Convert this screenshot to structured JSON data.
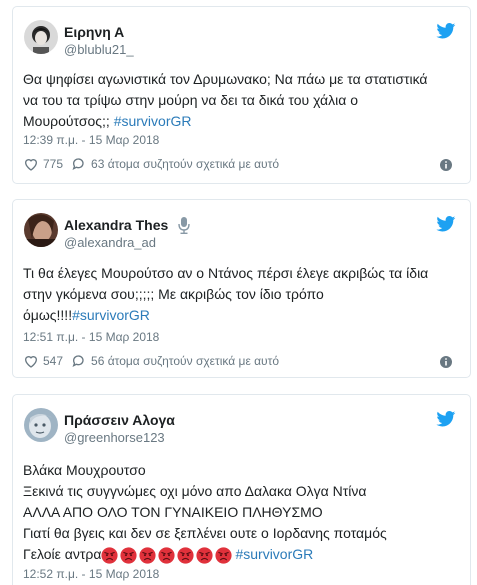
{
  "tweets": [
    {
      "name": "Ειρηνη Α",
      "handle": "@blublu21_",
      "text_lines": [
        "Θα ψηφίσει αγωνιστικά τον Δρυμωνακο; Να πάω με τα στατιστικά",
        "να του τα τρίψω στην μούρη να δει τα δικά του χάλια ο"
      ],
      "last_line_text": "Μουρούτσος;; ",
      "hashtag": "#survivorGR",
      "timestamp": "12:39 π.μ. - 15 Μαρ 2018",
      "likes": "775",
      "replies_text": "63 άτομα συζητούν σχετικά με αυτό"
    },
    {
      "name": "Alexandra Thes",
      "handle": "@alexandra_ad",
      "text_lines": [
        "Τι θα έλεγες Μουρούτσο αν ο Ντάνος πέρσι έλεγε ακριβώς τα ίδια",
        "στην γκόμενα σου;;;;; Με ακριβώς τον ίδιο τρόπο"
      ],
      "last_line_text": "όμως!!!!",
      "hashtag": "#survivorGR",
      "timestamp": "12:51 π.μ. - 15 Μαρ 2018",
      "likes": "547",
      "replies_text": "56 άτομα συζητούν σχετικά με αυτό"
    },
    {
      "name": "Πράσσειν Αλογα",
      "handle": "@greenhorse123",
      "text_lines": [
        "Βλάκα Μουχρουτσο",
        "Ξεκινά τις συγγνώμες οχι μόνο απο Δαλακα Ολγα Ντίνα",
        "ΑΛΛΑ ΑΠΟ ΟΛΟ ΤΟΝ ΓΥΝΑΙΚΕΙΟ ΠΛΗΘΥΣΜΟ",
        "Γιατί θα βγεις και δεν σε ξεπλένει ουτε ο Ιορδανης ποταμός"
      ],
      "last_line_text": "Γελοίε αντρα",
      "emoji_count": 7,
      "hashtag": "#survivorGR",
      "timestamp": "12:52 π.μ. - 15 Μαρ 2018"
    }
  ],
  "colors": {
    "twitter_blue": "#1da1f2",
    "link": "#2b7bb9",
    "muted": "#697882",
    "border": "#e1e8ed",
    "emoji_red": "#e0313b"
  },
  "icons": {
    "logo": "twitter-bird-icon",
    "like": "heart-icon",
    "reply": "comment-bubble-icon",
    "info": "info-icon",
    "mic": "microphone-icon",
    "emoji": "angry-face-emoji"
  }
}
